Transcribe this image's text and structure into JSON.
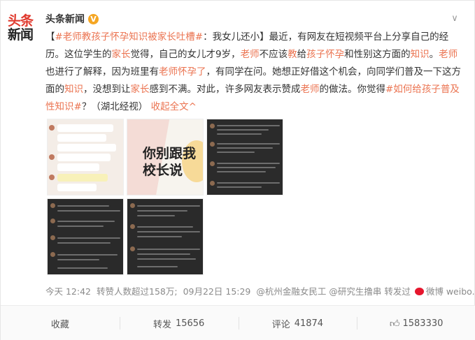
{
  "author": {
    "avatar_line1": "头条",
    "avatar_line2": "新闻",
    "name": "头条新闻",
    "verified_mark": "V"
  },
  "post": {
    "segments": [
      {
        "text": "【",
        "kind": "plain"
      },
      {
        "text": "#老师教孩子怀孕知识被家长吐槽#",
        "kind": "link"
      },
      {
        "text": "：我女儿还小】最近，有网友在短视频平台上分享自己的经历。这位学生的",
        "kind": "plain"
      },
      {
        "text": "家长",
        "kind": "hl"
      },
      {
        "text": "觉得，自己的女儿才9岁，",
        "kind": "plain"
      },
      {
        "text": "老师",
        "kind": "hl"
      },
      {
        "text": "不应该",
        "kind": "plain"
      },
      {
        "text": "教",
        "kind": "hl"
      },
      {
        "text": "给",
        "kind": "plain"
      },
      {
        "text": "孩子怀孕",
        "kind": "hl"
      },
      {
        "text": "和性别这方面的",
        "kind": "plain"
      },
      {
        "text": "知识",
        "kind": "hl"
      },
      {
        "text": "。",
        "kind": "plain"
      },
      {
        "text": "老师",
        "kind": "hl"
      },
      {
        "text": "也进行了解释，因为班里有",
        "kind": "plain"
      },
      {
        "text": "老师怀孕了",
        "kind": "hl"
      },
      {
        "text": "，有同学在问。她想正好借这个机会，向同学们普及一下这方面的",
        "kind": "plain"
      },
      {
        "text": "知识",
        "kind": "hl"
      },
      {
        "text": "，没想到让",
        "kind": "plain"
      },
      {
        "text": "家长",
        "kind": "hl"
      },
      {
        "text": "感到不满。对此，许多网友表示赞成",
        "kind": "plain"
      },
      {
        "text": "老师",
        "kind": "hl"
      },
      {
        "text": "的做法。你觉得",
        "kind": "plain"
      },
      {
        "text": "#如何给",
        "kind": "link"
      },
      {
        "text": "孩子",
        "kind": "hl"
      },
      {
        "text": "普及性",
        "kind": "link"
      },
      {
        "text": "知识",
        "kind": "hl"
      },
      {
        "text": "#",
        "kind": "link"
      },
      {
        "text": "？（湖北经视）",
        "kind": "plain"
      }
    ],
    "expand_label": "收起全文",
    "expand_arrow": "^"
  },
  "image2": {
    "line1": "你别跟我",
    "line2": "校长说"
  },
  "meta": {
    "time": "今天 12:42",
    "reads": "转赞人数超过158万;",
    "date": "09月22日 15:29",
    "via": "@杭州金融女民工 @研究生撸串 转发过",
    "source": "微博 weibo.com"
  },
  "actions": {
    "favorite": "收藏",
    "repost_label": "转发",
    "repost_count": "15656",
    "comment_label": "评论",
    "comment_count": "41874",
    "like_count": "1583330"
  }
}
